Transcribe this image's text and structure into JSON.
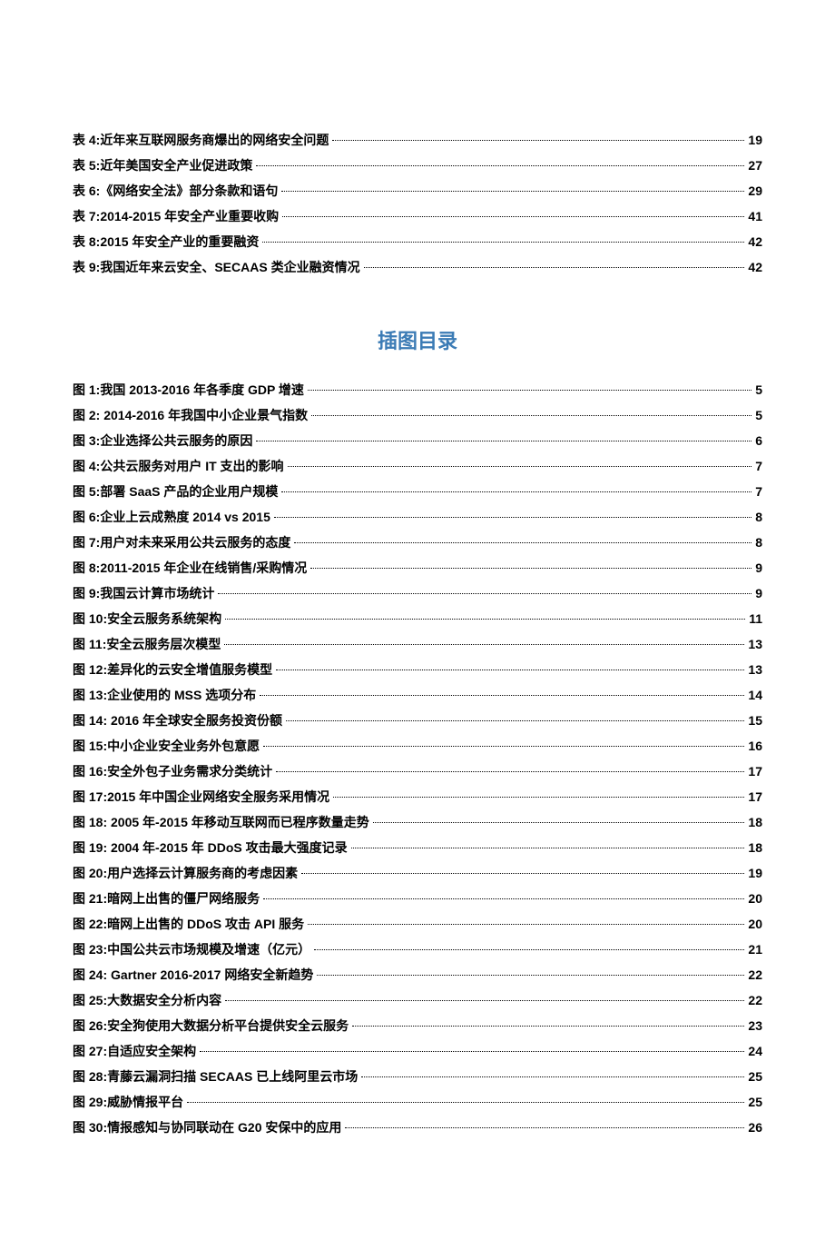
{
  "tables": [
    {
      "label": "表 4:近年来互联网服务商爆出的网络安全问题",
      "page": "19"
    },
    {
      "label": "表 5:近年美国安全产业促进政策",
      "page": "27"
    },
    {
      "label": "表 6:《网络安全法》部分条款和语句",
      "page": "29"
    },
    {
      "label": "表 7:2014-2015 年安全产业重要收购",
      "page": "41"
    },
    {
      "label": "表 8:2015 年安全产业的重要融资",
      "page": "42"
    },
    {
      "label": "表 9:我国近年来云安全、SECAAS 类企业融资情况",
      "page": "42"
    }
  ],
  "figures_title": "插图目录",
  "figures": [
    {
      "label": "图 1:我国 2013-2016 年各季度 GDP 增速",
      "page": "5"
    },
    {
      "label": "图 2: 2014-2016 年我国中小企业景气指数",
      "page": "5"
    },
    {
      "label": "图 3:企业选择公共云服务的原因",
      "page": "6"
    },
    {
      "label": "图 4:公共云服务对用户 IT 支出的影响",
      "page": "7"
    },
    {
      "label": "图 5:部署 SaaS 产品的企业用户规模",
      "page": "7"
    },
    {
      "label": "图 6:企业上云成熟度 2014 vs 2015",
      "page": "8"
    },
    {
      "label": "图 7:用户对未来采用公共云服务的态度",
      "page": "8"
    },
    {
      "label": "图 8:2011-2015 年企业在线销售/采购情况",
      "page": "9"
    },
    {
      "label": "图 9:我国云计算市场统计",
      "page": "9"
    },
    {
      "label": "图 10:安全云服务系统架构",
      "page": "11"
    },
    {
      "label": "图 11:安全云服务层次模型",
      "page": "13"
    },
    {
      "label": "图 12:差异化的云安全增值服务模型",
      "page": "13"
    },
    {
      "label": "图 13:企业使用的 MSS 选项分布",
      "page": "14"
    },
    {
      "label": "图 14: 2016 年全球安全服务投资份额",
      "page": "15"
    },
    {
      "label": "图 15:中小企业安全业务外包意愿",
      "page": "16"
    },
    {
      "label": "图 16:安全外包子业务需求分类统计",
      "page": "17"
    },
    {
      "label": "图 17:2015 年中国企业网络安全服务采用情况",
      "page": "17"
    },
    {
      "label": "图 18: 2005 年-2015 年移动互联网而已程序数量走势",
      "page": "18"
    },
    {
      "label": "图 19: 2004 年-2015 年 DDoS 攻击最大强度记录",
      "page": "18"
    },
    {
      "label": "图 20:用户选择云计算服务商的考虑因素",
      "page": "19"
    },
    {
      "label": "图 21:暗网上出售的僵尸网络服务",
      "page": "20"
    },
    {
      "label": "图 22:暗网上出售的 DDoS 攻击 API 服务",
      "page": "20"
    },
    {
      "label": "图 23:中国公共云市场规模及增速（亿元）",
      "page": "21"
    },
    {
      "label": "图 24: Gartner 2016-2017 网络安全新趋势",
      "page": "22"
    },
    {
      "label": "图 25:大数据安全分析内容",
      "page": "22"
    },
    {
      "label": "图 26:安全狗使用大数据分析平台提供安全云服务",
      "page": "23"
    },
    {
      "label": "图 27:自适应安全架构",
      "page": "24"
    },
    {
      "label": "图 28:青藤云漏洞扫描 SECAAS 已上线阿里云市场",
      "page": "25"
    },
    {
      "label": "图 29:威胁情报平台",
      "page": "25"
    },
    {
      "label": "图 30:情报感知与协同联动在 G20 安保中的应用",
      "page": "26"
    }
  ]
}
